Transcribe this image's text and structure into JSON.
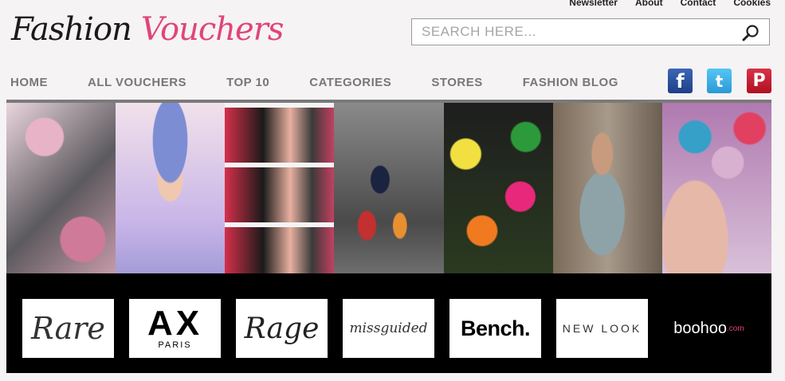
{
  "top_links": [
    "Newsletter",
    "About",
    "Contact",
    "Cookies"
  ],
  "logo": {
    "word1": "Fashion",
    "word2": "Vouchers"
  },
  "search": {
    "placeholder": "SEARCH HERE..."
  },
  "nav": [
    "HOME",
    "ALL VOUCHERS",
    "TOP 10",
    "CATEGORIES",
    "STORES",
    "FASHION BLOG"
  ],
  "social": {
    "facebook": "f",
    "twitter": "t",
    "pinterest": "P"
  },
  "brands": {
    "rare": "Rare",
    "ax_main": "AX",
    "ax_sub": "PARIS",
    "rage": "Rage",
    "missguided": "missguided",
    "bench": "Bench.",
    "newlook": "NEW LOOK",
    "boohoo": "boohoo",
    "boohoo_suffix": ".com"
  },
  "colors": {
    "accent": "#e0447a",
    "nav_text": "#777777",
    "brand_strip": "#000000"
  }
}
